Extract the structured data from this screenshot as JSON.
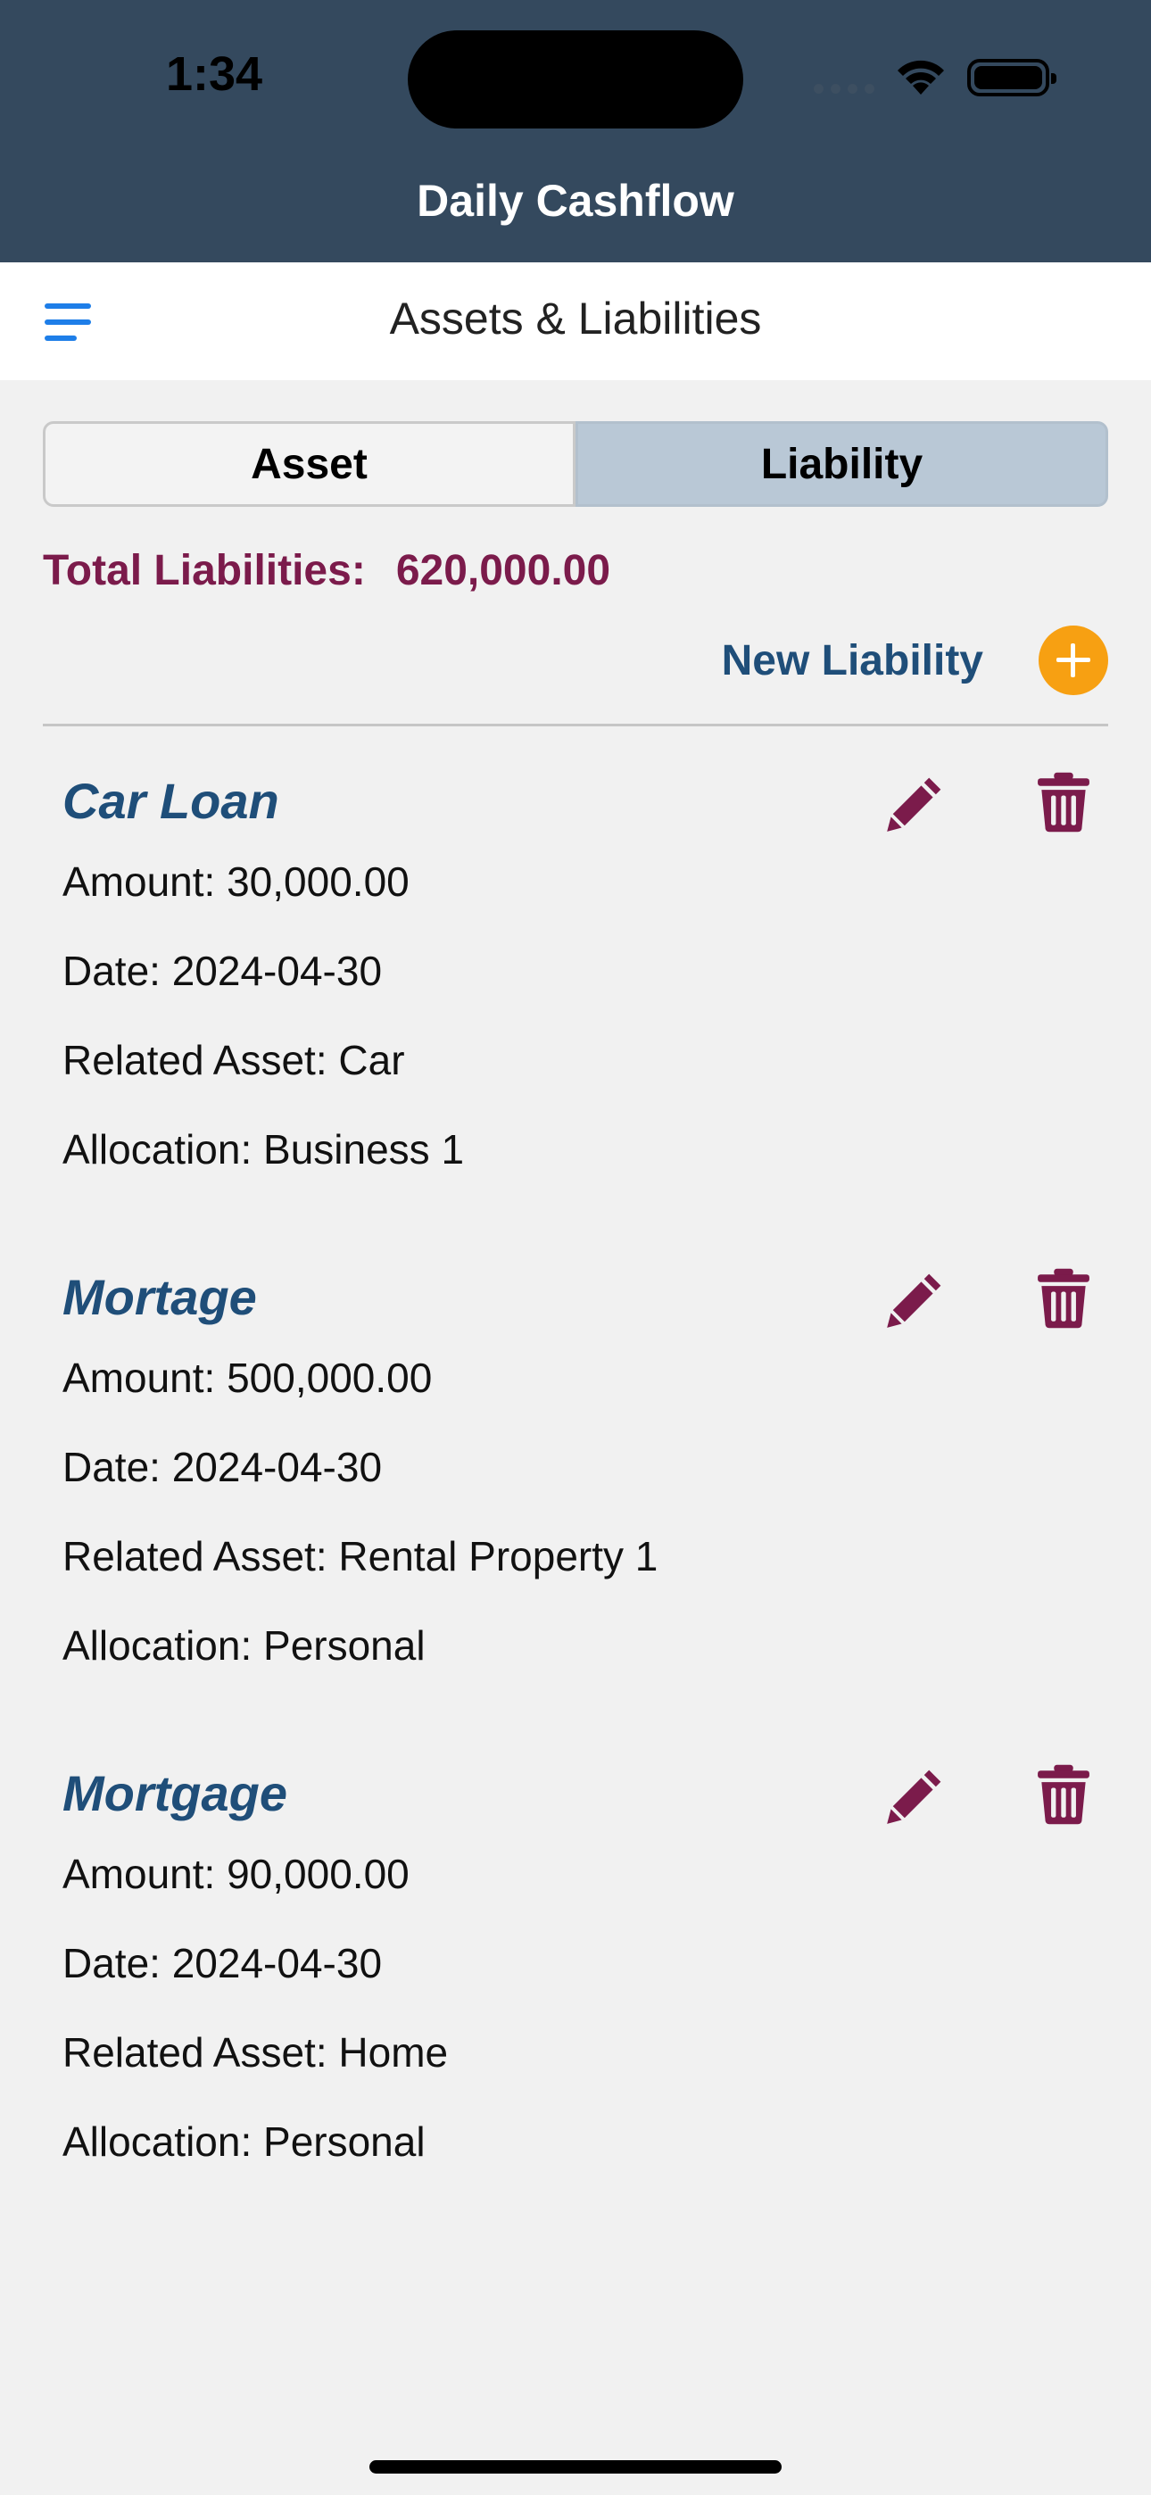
{
  "status_bar": {
    "time": "1:34"
  },
  "app": {
    "title": "Daily Cashflow"
  },
  "header": {
    "title": "Assets & Liabilities"
  },
  "tabs": [
    {
      "label": "Asset",
      "selected": false
    },
    {
      "label": "Liability",
      "selected": true
    }
  ],
  "summary": {
    "total_label": "Total Liabilities:",
    "total_value": "620,000.00"
  },
  "actions": {
    "new_label": "New Liability"
  },
  "liabilities": [
    {
      "name": "Car Loan",
      "amount": "Amount: 30,000.00",
      "date": "Date: 2024-04-30",
      "related_asset": "Related Asset: Car",
      "allocation": "Allocation: Business 1"
    },
    {
      "name": "Mortage",
      "amount": "Amount: 500,000.00",
      "date": "Date: 2024-04-30",
      "related_asset": "Related Asset: Rental Property 1",
      "allocation": "Allocation: Personal"
    },
    {
      "name": "Mortgage",
      "amount": "Amount: 90,000.00",
      "date": "Date: 2024-04-30",
      "related_asset": "Related Asset: Home",
      "allocation": "Allocation: Personal"
    }
  ],
  "icons": {
    "menu": "hamburger-icon",
    "add": "plus-circle-icon",
    "edit": "pencil-icon",
    "delete": "trash-icon"
  },
  "colors": {
    "topbar": "#34495e",
    "menu": "#1e7ee8",
    "total": "#7b1b4b",
    "accent_blue": "#1f4e79",
    "add_button": "#f7a012",
    "action_icons": "#7b1b4b",
    "selected_tab": "#b9c8d6",
    "background": "#f1f1f1"
  }
}
